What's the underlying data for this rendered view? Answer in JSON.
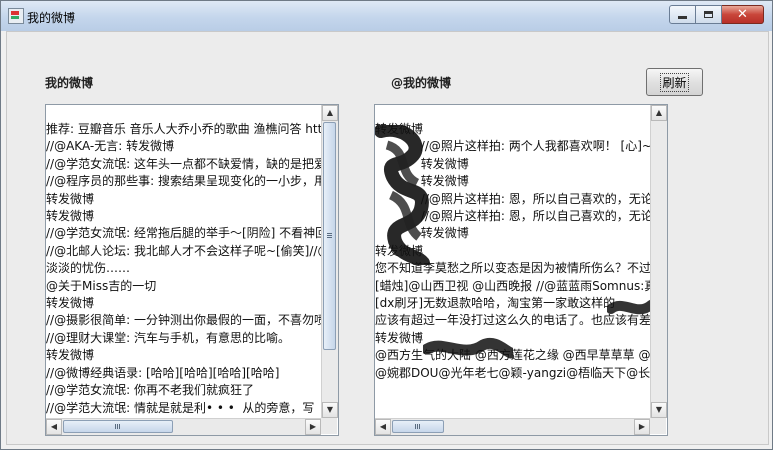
{
  "window": {
    "title": "我的微博"
  },
  "caption_buttons": {
    "minimize": "minimize-icon",
    "maximize": "maximize-icon",
    "close": "close-icon"
  },
  "labels": {
    "left": "我的微博",
    "right": "@我的微博"
  },
  "refresh_button": {
    "label": "刷新"
  },
  "left_feed": {
    "lines": [
      "推荐: 豆瓣音乐 音乐人大乔小乔的歌曲 渔樵问答 http",
      "//@AKA-无言: 转发微博",
      "//@学范女流氓: 这年头一点都不缺爱情，缺的是把爱",
      "//@程序员的那些事: 搜索结果呈现变化的一小步，用",
      "转发微博",
      "转发微博",
      "//@学范女流氓: 经常拖后腿的举手～[阴险] 不看神回",
      "//@北邮人论坛: 我北邮人才不会这样子呢~[偷笑]//@",
      "淡淡的忧伤……",
      "@关于Miss吉的一切",
      "转发微博",
      "//@摄影很简单: 一分钟测出你最假的一面，不喜勿喷",
      "//@理财大课堂: 汽车与手机，有意思的比喻。",
      "转发微博",
      "//@微博经典语录: [哈哈][哈哈][哈哈][哈哈]",
      "//@学范女流氓: 你再不老我们就疯狂了",
      "//@学范大流氓: 情就是就是利• • •  从的旁意，写"
    ]
  },
  "right_feed": {
    "lines": [
      "转发微博",
      "            //@照片这样拍: 两个人我都喜欢啊！ [心]~~",
      "            转发微博",
      "            转发微博",
      "            //@照片这样拍: 恩，所以自己喜欢的，无论结",
      "            //@照片这样拍: 恩，所以自己喜欢的，无论结",
      "            转发微博",
      "转发微博",
      "您不知道李莫愁之所以变态是因为被情所伤么？不过是一",
      "[蜡烛]@山西卫视 @山西晚报 //@蓝蓝雨Somnus:真实事",
      "[dx刷牙]无数退款哈哈，淘宝第一家敢这样的",
      "应该有超过一年没打过这么久的电话了。也应该有差不多",
      "转发微博",
      "@西方生气的大陆 @西方莲花之缘 @西早草草草 @西有",
      "@婉郡DOU@光年老七@颖-yangzi@梧临天下@长春连"
    ]
  },
  "scroll_icons": {
    "up": "up-arrow-icon",
    "down": "down-arrow-icon",
    "left": "left-arrow-icon",
    "right": "right-arrow-icon"
  }
}
